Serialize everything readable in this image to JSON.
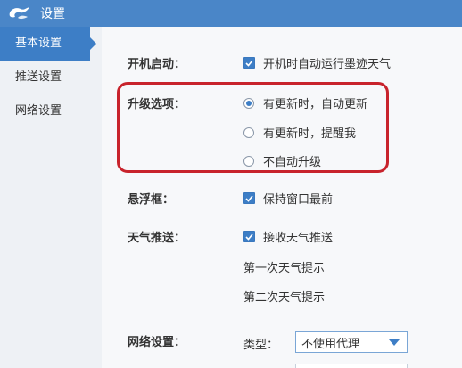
{
  "window": {
    "title": "设置"
  },
  "sidebar": {
    "items": [
      {
        "label": "基本设置"
      },
      {
        "label": "推送设置"
      },
      {
        "label": "网络设置"
      }
    ]
  },
  "main": {
    "startup": {
      "label": "开机启动：",
      "option": "开机时自动运行墨迹天气",
      "checked": true
    },
    "upgrade": {
      "label": "升级选项：",
      "options": [
        {
          "label": "有更新时，自动更新",
          "selected": true
        },
        {
          "label": "有更新时，提醒我",
          "selected": false
        },
        {
          "label": "不自动升级",
          "selected": false
        }
      ]
    },
    "floating": {
      "label": "悬浮框：",
      "option": "保持窗口最前",
      "checked": true
    },
    "weather_push": {
      "label": "天气推送：",
      "option": "接收天气推送",
      "checked": true,
      "first_hint": "第一次天气提示",
      "second_hint": "第二次天气提示"
    },
    "network": {
      "label": "网络设置：",
      "type_label": "类型：",
      "type_value": "不使用代理"
    }
  },
  "colors": {
    "accent": "#3d7ec6",
    "titlebar": "#4a86c8",
    "highlight": "#c8232c"
  }
}
